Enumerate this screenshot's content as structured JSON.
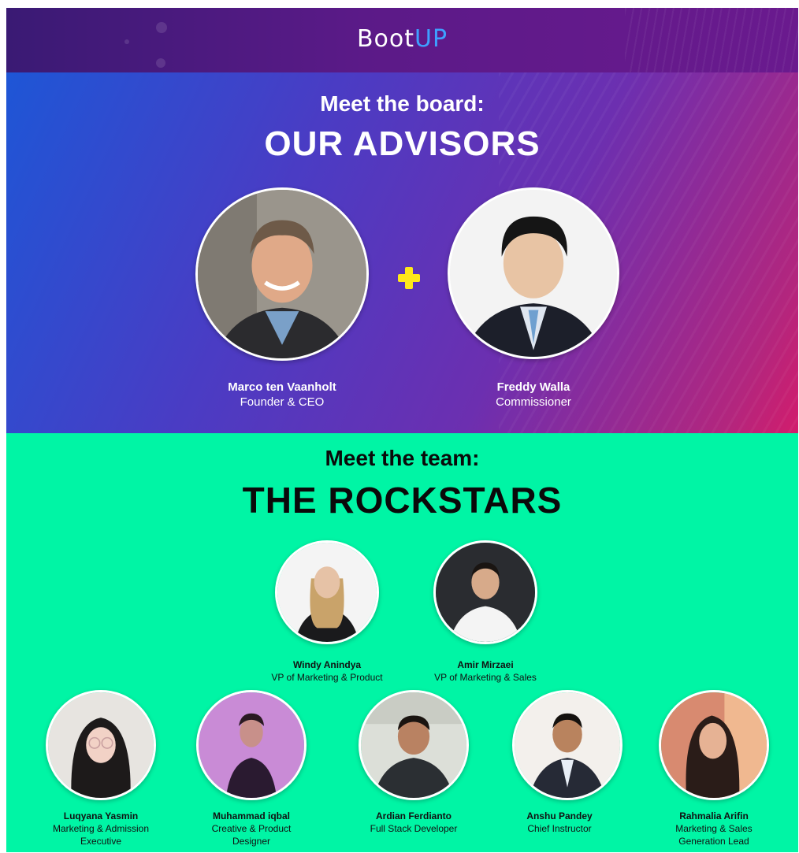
{
  "brand": {
    "logo_part1": "Boot",
    "logo_part2": "UP",
    "accent": "#3ea0ff"
  },
  "advisors": {
    "kicker": "Meet the board:",
    "title": "OUR ADVISORS",
    "people": [
      {
        "name": "Marco ten Vaanholt",
        "role": "Founder & CEO"
      },
      {
        "name": "Freddy Walla",
        "role": "Commissioner"
      }
    ],
    "connector_icon": "plus-icon",
    "connector_color": "#ffe81a"
  },
  "team": {
    "kicker": "Meet the team:",
    "title": "THE ROCKSTARS",
    "background": "#00f5a5",
    "leads": [
      {
        "name": "Windy Anindya",
        "role": "VP of Marketing & Product"
      },
      {
        "name": "Amir Mirzaei",
        "role": "VP of Marketing & Sales"
      }
    ],
    "members": [
      {
        "name": "Luqyana Yasmin",
        "role_line1": "Marketing & Admission",
        "role_line2": "Executive"
      },
      {
        "name": "Muhammad iqbal",
        "role_line1": "Creative & Product",
        "role_line2": "Designer"
      },
      {
        "name": "Ardian Ferdianto",
        "role_line1": "Full Stack Developer",
        "role_line2": ""
      },
      {
        "name": "Anshu Pandey",
        "role_line1": "Chief Instructor",
        "role_line2": ""
      },
      {
        "name": "Rahmalia Arifin",
        "role_line1": "Marketing & Sales",
        "role_line2": "Generation Lead"
      }
    ]
  }
}
